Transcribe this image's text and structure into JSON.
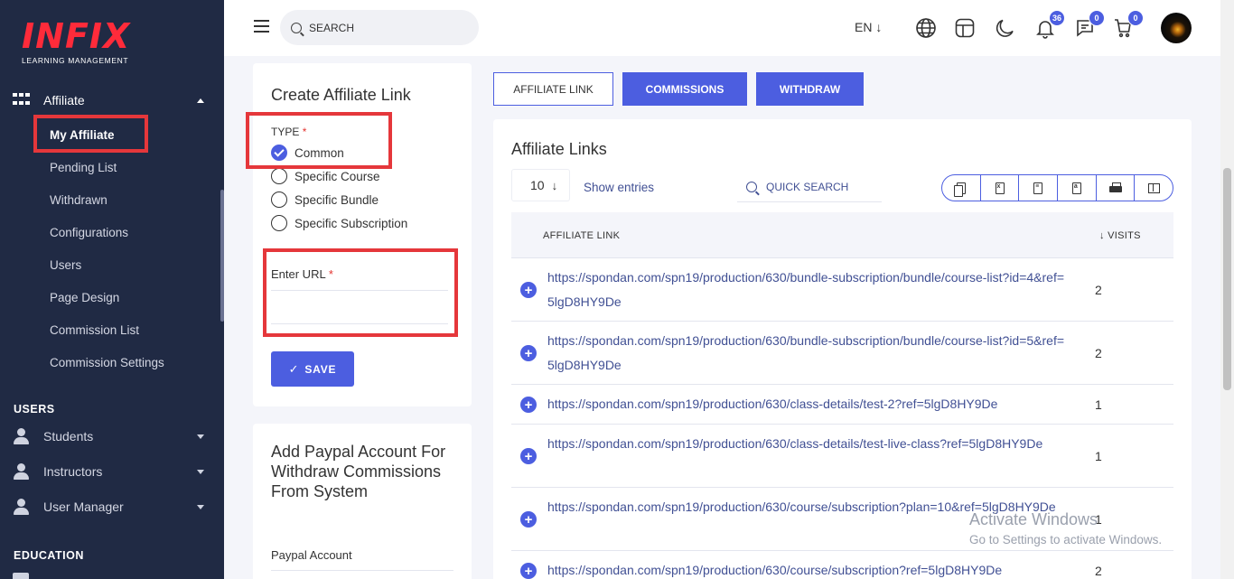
{
  "sidebar": {
    "logo_main": "INFIX",
    "logo_sub": "LEARNING MANAGEMENT",
    "affiliate_label": "Affiliate",
    "sub_items": [
      "My Affiliate",
      "Pending List",
      "Withdrawn",
      "Configurations",
      "Users",
      "Page Design",
      "Commission List",
      "Commission Settings"
    ],
    "users_section": "USERS",
    "user_groups": [
      "Students",
      "Instructors",
      "User Manager"
    ],
    "education_section": "EDUCATION"
  },
  "topbar": {
    "search_placeholder": "SEARCH",
    "language": "EN ↓",
    "notification_count": "36",
    "message_count": "0",
    "cart_count": "0"
  },
  "create_form": {
    "title": "Create Affiliate Link",
    "type_label": "TYPE",
    "required_mark": "*",
    "options": [
      "Common",
      "Specific Course",
      "Specific Bundle",
      "Specific Subscription"
    ],
    "selected": "Common",
    "url_label": "Enter URL",
    "save_label": "SAVE"
  },
  "paypal_form": {
    "title": "Add Paypal Account For Withdraw Commissions From System",
    "account_label": "Paypal Account"
  },
  "tabs": [
    "AFFILIATE LINK",
    "COMMISSIONS",
    "WITHDRAW"
  ],
  "links_table": {
    "title": "Affiliate Links",
    "entries_value": "10",
    "show_entries": "Show entries",
    "quick_search_placeholder": "QUICK SEARCH",
    "columns": [
      "AFFILIATE LINK",
      "↓ VISITS"
    ],
    "rows": [
      {
        "link": "https://spondan.com/spn19/production/630/bundle-subscription/bundle/course-list?id=4&ref=5lgD8HY9De",
        "visits": "2"
      },
      {
        "link": "https://spondan.com/spn19/production/630/bundle-subscription/bundle/course-list?id=5&ref=5lgD8HY9De",
        "visits": "2"
      },
      {
        "link": "https://spondan.com/spn19/production/630/class-details/test-2?ref=5lgD8HY9De",
        "visits": "1"
      },
      {
        "link": "https://spondan.com/spn19/production/630/class-details/test-live-class?ref=5lgD8HY9De",
        "visits": "1"
      },
      {
        "link": "https://spondan.com/spn19/production/630/course/subscription?plan=10&ref=5lgD8HY9De",
        "visits": "1"
      },
      {
        "link": "https://spondan.com/spn19/production/630/course/subscription?ref=5lgD8HY9De",
        "visits": "2"
      }
    ]
  },
  "watermark": {
    "line1": "Activate Windows",
    "line2": "Go to Settings to activate Windows."
  },
  "colors": {
    "accent": "#4c5ee0",
    "sidebar_bg": "#202a44",
    "highlight": "#e5373b",
    "logo_red": "#ff2b3a"
  }
}
